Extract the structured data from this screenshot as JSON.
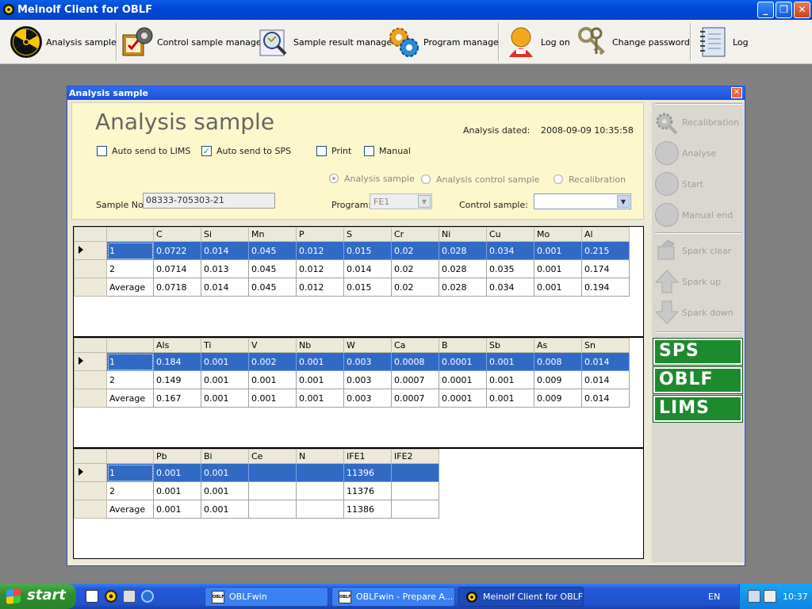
{
  "window": {
    "title": "Meinolf Client for OBLF"
  },
  "toolbar": [
    {
      "label": "Analysis sample",
      "icon": "radiation-icon"
    },
    {
      "label": "Control sample manage",
      "icon": "control-checklist-icon"
    },
    {
      "label": "Sample result manage",
      "icon": "magnifier-chart-icon"
    },
    {
      "label": "Program manage",
      "icon": "gears-icon"
    },
    {
      "label": "Log on",
      "icon": "user-icon"
    },
    {
      "label": "Change password",
      "icon": "keys-icon"
    },
    {
      "label": "Log",
      "icon": "notebook-icon"
    }
  ],
  "child": {
    "title": "Analysis sample"
  },
  "header": {
    "heading": "Analysis sample",
    "dated_label": "Analysis dated:",
    "dated_value": "2008-09-09 10:35:58",
    "checks": [
      {
        "label": "Auto send to LIMS",
        "checked": false
      },
      {
        "label": "Auto send to SPS",
        "checked": true
      },
      {
        "label": "Print",
        "checked": false
      },
      {
        "label": "Manual",
        "checked": false
      }
    ],
    "radios": [
      {
        "label": "Analysis sample",
        "selected": true
      },
      {
        "label": "Analysis control sample",
        "selected": false
      },
      {
        "label": "Recalibration",
        "selected": false
      }
    ],
    "sample_no_label": "Sample No:",
    "sample_no_value": "08333-705303-21",
    "program_label": "Program:",
    "program_value": "FE1",
    "control_label": "Control sample:",
    "control_value": ""
  },
  "grids": [
    {
      "columns": [
        "C",
        "Si",
        "Mn",
        "P",
        "S",
        "Cr",
        "Ni",
        "Cu",
        "Mo",
        "Al"
      ],
      "rows": [
        {
          "name": "1",
          "values": [
            "0.0722",
            "0.014",
            "0.045",
            "0.012",
            "0.015",
            "0.02",
            "0.028",
            "0.034",
            "0.001",
            "0.215"
          ]
        },
        {
          "name": "2",
          "values": [
            "0.0714",
            "0.013",
            "0.045",
            "0.012",
            "0.014",
            "0.02",
            "0.028",
            "0.035",
            "0.001",
            "0.174"
          ]
        },
        {
          "name": "Average",
          "values": [
            "0.0718",
            "0.014",
            "0.045",
            "0.012",
            "0.015",
            "0.02",
            "0.028",
            "0.034",
            "0.001",
            "0.194"
          ]
        }
      ]
    },
    {
      "columns": [
        "Als",
        "Ti",
        "V",
        "Nb",
        "W",
        "Ca",
        "B",
        "Sb",
        "As",
        "Sn"
      ],
      "rows": [
        {
          "name": "1",
          "values": [
            "0.184",
            "0.001",
            "0.002",
            "0.001",
            "0.003",
            "0.0008",
            "0.0001",
            "0.001",
            "0.008",
            "0.014"
          ]
        },
        {
          "name": "2",
          "values": [
            "0.149",
            "0.001",
            "0.001",
            "0.001",
            "0.003",
            "0.0007",
            "0.0001",
            "0.001",
            "0.009",
            "0.014"
          ]
        },
        {
          "name": "Average",
          "values": [
            "0.167",
            "0.001",
            "0.001",
            "0.001",
            "0.003",
            "0.0007",
            "0.0001",
            "0.001",
            "0.009",
            "0.014"
          ]
        }
      ]
    },
    {
      "columns": [
        "Pb",
        "Bi",
        "Ce",
        "N",
        "IFE1",
        "IFE2"
      ],
      "rows": [
        {
          "name": "1",
          "values": [
            "0.001",
            "0.001",
            "",
            "",
            "11396",
            ""
          ]
        },
        {
          "name": "2",
          "values": [
            "0.001",
            "0.001",
            "",
            "",
            "11376",
            ""
          ]
        },
        {
          "name": "Average",
          "values": [
            "0.001",
            "0.001",
            "",
            "",
            "11386",
            ""
          ]
        }
      ]
    }
  ],
  "side": {
    "buttons": [
      {
        "label": "Recalibration",
        "icon": "gear-wrench-icon"
      },
      {
        "label": "Analyse",
        "icon": "circle-icon"
      },
      {
        "label": "Start",
        "icon": "circle-icon"
      },
      {
        "label": "Manual end",
        "icon": "circle-icon"
      },
      {
        "label": "Spark clear",
        "icon": "brush-icon"
      },
      {
        "label": "Spark up",
        "icon": "arrow-up-icon"
      },
      {
        "label": "Spark down",
        "icon": "arrow-down-icon"
      }
    ],
    "sps": "SPS",
    "oblf": "OBLF",
    "lims": "LIMS"
  },
  "taskbar": {
    "start": "start",
    "tasks": [
      "OBLFwin",
      "OBLFwin - Prepare A...",
      "Meinolf Client for OBLF"
    ],
    "task_icon_text": "OBLF",
    "lang": "EN",
    "clock": "10:37"
  },
  "colors": {
    "selected_row": "#316ac5",
    "brand_green": "#1e8a2e",
    "header_bg": "#fdf7cc"
  }
}
